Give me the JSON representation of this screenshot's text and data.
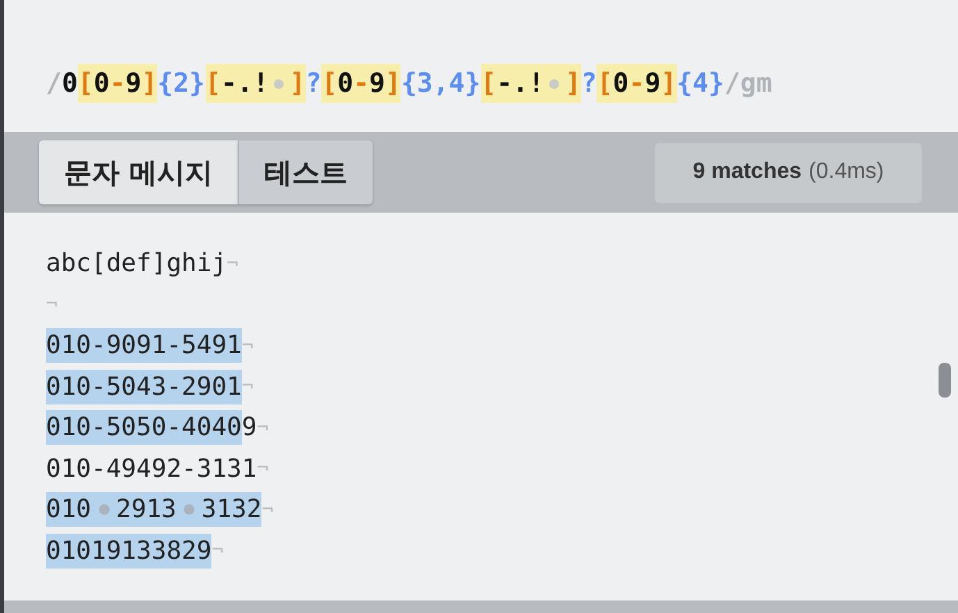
{
  "expression": {
    "tokens": [
      {
        "kind": "delim",
        "text": "/"
      },
      {
        "kind": "literal",
        "text": "0"
      },
      {
        "kind": "set",
        "parts": [
          {
            "kind": "bracket",
            "text": "["
          },
          {
            "kind": "char",
            "text": "0"
          },
          {
            "kind": "range",
            "text": "-"
          },
          {
            "kind": "char",
            "text": "9"
          },
          {
            "kind": "bracket",
            "text": "]"
          }
        ]
      },
      {
        "kind": "quant",
        "text": "{2}"
      },
      {
        "kind": "set",
        "parts": [
          {
            "kind": "bracket",
            "text": "["
          },
          {
            "kind": "char",
            "text": "-.!"
          },
          {
            "kind": "space"
          },
          {
            "kind": "bracket",
            "text": "]"
          }
        ]
      },
      {
        "kind": "quant",
        "text": "?"
      },
      {
        "kind": "set",
        "parts": [
          {
            "kind": "bracket",
            "text": "["
          },
          {
            "kind": "char",
            "text": "0"
          },
          {
            "kind": "range",
            "text": "-"
          },
          {
            "kind": "char",
            "text": "9"
          },
          {
            "kind": "bracket",
            "text": "]"
          }
        ]
      },
      {
        "kind": "quant",
        "text": "{3,4}"
      },
      {
        "kind": "set",
        "parts": [
          {
            "kind": "bracket",
            "text": "["
          },
          {
            "kind": "char",
            "text": "-.!"
          },
          {
            "kind": "space"
          },
          {
            "kind": "bracket",
            "text": "]"
          }
        ]
      },
      {
        "kind": "quant",
        "text": "?"
      },
      {
        "kind": "set",
        "parts": [
          {
            "kind": "bracket",
            "text": "["
          },
          {
            "kind": "char",
            "text": "0"
          },
          {
            "kind": "range",
            "text": "-"
          },
          {
            "kind": "char",
            "text": "9"
          },
          {
            "kind": "bracket",
            "text": "]"
          }
        ]
      },
      {
        "kind": "quant",
        "text": "{4}"
      },
      {
        "kind": "delim",
        "text": "/gm"
      }
    ]
  },
  "tabs": [
    {
      "label": "문자 메시지",
      "selected": true
    },
    {
      "label": "테스트",
      "selected": false
    }
  ],
  "result": {
    "count": "9 matches",
    "time": "(0.4ms)"
  },
  "lines": [
    {
      "segments": [
        {
          "kind": "text",
          "text": "abc[def]ghij",
          "match": false
        }
      ],
      "eol": "¬"
    },
    {
      "eol": "¬"
    },
    {
      "segments": [
        {
          "kind": "text",
          "text": "010-9091-5491",
          "match": true
        }
      ],
      "eol": "¬"
    },
    {
      "segments": [
        {
          "kind": "text",
          "text": "010-5043-2901",
          "match": true
        }
      ],
      "eol": "¬"
    },
    {
      "segments": [
        {
          "kind": "text",
          "text": "010-5050-4040",
          "match": true
        },
        {
          "kind": "text",
          "text": "9",
          "match": false
        }
      ],
      "eol": "¬"
    },
    {
      "segments": [
        {
          "kind": "text",
          "text": "010-49492-3131",
          "match": false
        }
      ],
      "eol": "¬"
    },
    {
      "segments": [
        {
          "kind": "text",
          "text": "010",
          "match": true
        },
        {
          "kind": "space",
          "match": true
        },
        {
          "kind": "text",
          "text": "2913",
          "match": true
        },
        {
          "kind": "space",
          "match": true
        },
        {
          "kind": "text",
          "text": "3132",
          "match": true
        }
      ],
      "eol": "¬"
    },
    {
      "segments": [
        {
          "kind": "text",
          "text": "01019133829",
          "match": true
        }
      ],
      "eol": "¬"
    }
  ]
}
